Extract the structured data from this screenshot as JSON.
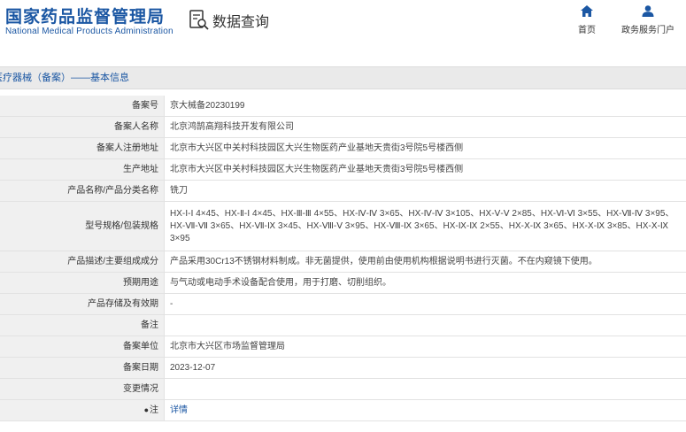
{
  "header": {
    "logo_cn": "国家药品监督管理局",
    "logo_en": "National Medical Products Administration",
    "search_title": "数据查询",
    "nav": [
      {
        "label": "首页",
        "icon": "home-icon"
      },
      {
        "label": "政务服务门户",
        "icon": "user-icon"
      }
    ]
  },
  "breadcrumb": "医疗器械（备案）——基本信息",
  "rows": [
    {
      "label": "备案号",
      "value": "京大械备20230199"
    },
    {
      "label": "备案人名称",
      "value": "北京鸿鹄高翔科技开发有限公司"
    },
    {
      "label": "备案人注册地址",
      "value": "北京市大兴区中关村科技园区大兴生物医药产业基地天贵街3号院5号楼西侧"
    },
    {
      "label": "生产地址",
      "value": "北京市大兴区中关村科技园区大兴生物医药产业基地天贵街3号院5号楼西侧"
    },
    {
      "label": "产品名称/产品分类名称",
      "value": "铣刀"
    },
    {
      "label": "型号规格/包装规格",
      "value": "HX-Ⅰ-Ⅰ 4×45、HX-Ⅱ-Ⅰ 4×45、HX-Ⅲ-Ⅲ 4×55、HX-Ⅳ-Ⅳ 3×65、HX-Ⅳ-Ⅳ 3×105、HX-Ⅴ-Ⅴ 2×85、HX-Ⅵ-Ⅵ 3×55、HX-Ⅶ-Ⅳ 3×95、HX-Ⅶ-Ⅶ 3×65、HX-Ⅶ-Ⅸ 3×45、HX-Ⅷ-Ⅴ 3×95、HX-Ⅷ-Ⅸ 3×65、HX-Ⅸ-Ⅸ 2×55、HX-Ⅹ-Ⅸ 3×65、HX-Ⅹ-Ⅸ 3×85、HX-Ⅹ-Ⅸ 3×95"
    },
    {
      "label": "产品描述/主要组成成分",
      "value": "产品采用30Cr13不锈钢材料制成。非无菌提供，使用前由使用机构根据说明书进行灭菌。不在内窥镜下使用。"
    },
    {
      "label": "预期用途",
      "value": "与气动或电动手术设备配合使用，用于打磨、切削组织。"
    },
    {
      "label": "产品存储及有效期",
      "value": "-"
    },
    {
      "label": "备注",
      "value": ""
    },
    {
      "label": "备案单位",
      "value": "北京市大兴区市场监督管理局"
    },
    {
      "label": "备案日期",
      "value": "2023-12-07"
    },
    {
      "label": "变更情况",
      "value": ""
    },
    {
      "label": "注",
      "value": "详情"
    }
  ],
  "colors": {
    "brand": "#1b57a3",
    "label_bg": "#f0f0f0",
    "crumb_bg": "#eaeaea"
  }
}
